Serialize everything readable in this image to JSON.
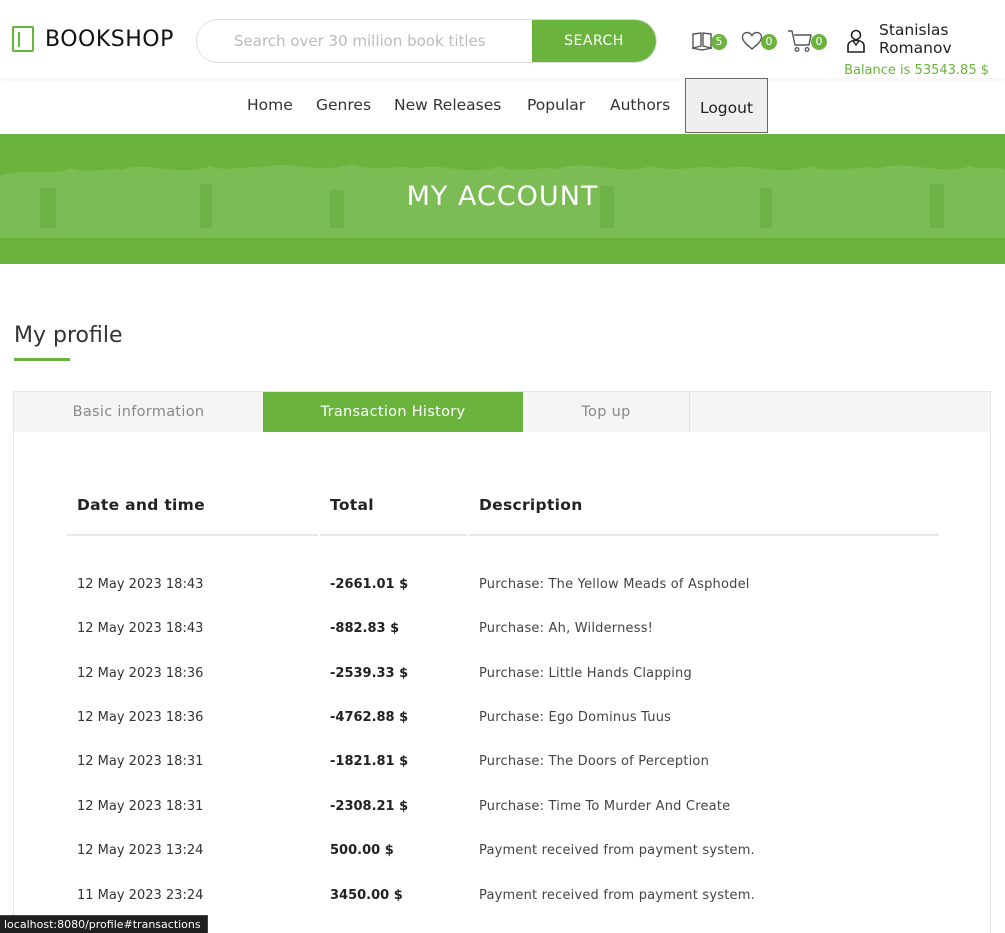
{
  "header": {
    "logo_text": "BOOKSHOP",
    "search_placeholder": "Search over 30 million book titles",
    "search_button": "SEARCH",
    "postponed_count": "5",
    "wishlist_count": "0",
    "cart_count": "0",
    "user_name": "Stanislas Romanov",
    "balance": "Balance is 53543.85 $"
  },
  "nav": {
    "items": [
      "Home",
      "Genres",
      "New Releases",
      "Popular",
      "Authors"
    ],
    "logout": "Logout"
  },
  "banner": {
    "title": "MY ACCOUNT"
  },
  "profile": {
    "title": "My profile",
    "tabs": [
      "Basic information",
      "Transaction History",
      "Top up"
    ],
    "active_tab": "Transaction History"
  },
  "transactions": {
    "headers": [
      "Date and time",
      "Total",
      "Description"
    ],
    "rows": [
      {
        "date": "12 May 2023 18:43",
        "total": "-2661.01 $",
        "description": "Purchase: The Yellow Meads of Asphodel"
      },
      {
        "date": "12 May 2023 18:43",
        "total": "-882.83 $",
        "description": "Purchase: Ah, Wilderness!"
      },
      {
        "date": "12 May 2023 18:36",
        "total": "-2539.33 $",
        "description": "Purchase: Little Hands Clapping"
      },
      {
        "date": "12 May 2023 18:36",
        "total": "-4762.88 $",
        "description": "Purchase: Ego Dominus Tuus"
      },
      {
        "date": "12 May 2023 18:31",
        "total": "-1821.81 $",
        "description": "Purchase: The Doors of Perception"
      },
      {
        "date": "12 May 2023 18:31",
        "total": "-2308.21 $",
        "description": "Purchase: Time To Murder And Create"
      },
      {
        "date": "12 May 2023 13:24",
        "total": "500.00 $",
        "description": "Payment received from payment system."
      },
      {
        "date": "11 May 2023 23:24",
        "total": "3450.00 $",
        "description": "Payment received from payment system."
      }
    ]
  },
  "status_bar": {
    "url": "localhost:8080/profile#transactions"
  },
  "colors": {
    "accent": "#6ab43e",
    "text": "#222222",
    "tab_bg": "#f5f5f5"
  },
  "icons": [
    "book-icon",
    "postponed-icon",
    "heart-icon",
    "cart-icon",
    "user-icon"
  ]
}
